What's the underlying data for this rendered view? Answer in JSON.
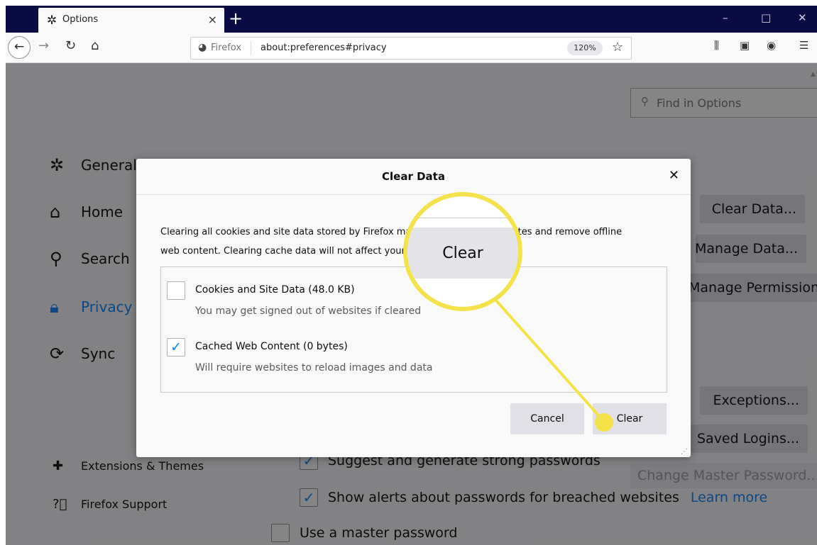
{
  "tab": {
    "title": "Options",
    "close": "×",
    "new": "+"
  },
  "window_controls": {
    "min": "–",
    "max": "□",
    "close": "✕"
  },
  "navbar": {
    "identity": "Firefox",
    "url": "about:preferences#privacy",
    "zoom": "120%"
  },
  "find": {
    "placeholder": "Find in Options"
  },
  "sidebar": {
    "items": [
      {
        "label": "General",
        "icon": "gear-icon"
      },
      {
        "label": "Home",
        "icon": "home-icon"
      },
      {
        "label": "Search",
        "icon": "search-icon"
      },
      {
        "label": "Privacy",
        "icon": "lock-icon"
      },
      {
        "label": "Sync",
        "icon": "sync-icon"
      }
    ],
    "extensions": "Extensions & Themes",
    "support": "Firefox Support"
  },
  "right_buttons": {
    "clear_data": "Clear Data...",
    "manage_data": "Manage Data...",
    "manage_permissions": "Manage Permissions...",
    "exceptions": "Exceptions...",
    "saved_logins": "Saved Logins..."
  },
  "passwords": {
    "suggest": "Suggest and generate strong passwords",
    "alerts": "Show alerts about passwords for breached websites",
    "learn_more": "Learn more",
    "master": "Use a master password",
    "change_master": "Change Master Password..."
  },
  "dialog": {
    "title": "Clear Data",
    "description_line1": "Clearing all cookies and site data stored by Firefox may sign you out of websites and remove offline",
    "description_line2": "web content. Clearing cache data will not affect your logins.",
    "options": [
      {
        "label": "Cookies and Site Data (48.0 KB)",
        "sub": "You may get signed out of websites if cleared",
        "checked": false
      },
      {
        "label": "Cached Web Content (0 bytes)",
        "sub": "Will require websites to reload images and data",
        "checked": true
      }
    ],
    "cancel": "Cancel",
    "clear": "Clear"
  },
  "callout": {
    "text": "Clear",
    "color": "#f4e24a"
  },
  "colors": {
    "titlebar": "#0c0c45",
    "accent": "#0a84ff"
  }
}
